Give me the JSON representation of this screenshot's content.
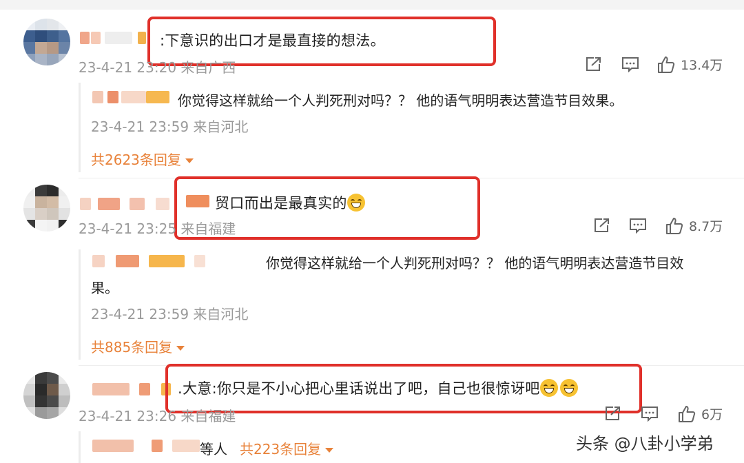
{
  "comments": [
    {
      "text": ":下意识的出口才是最直接的想法。",
      "meta": "23-4-21 23:20 来自广西",
      "likes": "13.4万",
      "reply": {
        "text": "你觉得这样就给一个人判死刑对吗？？ 他的语气明明表达营造节目效果。",
        "meta": "23-4-21 23:59 来自河北"
      },
      "more_replies": "共2623条回复"
    },
    {
      "text": "贸口而出是最真实的",
      "meta": "23-4-21 23:25 来自福建",
      "likes": "8.7万",
      "reply": {
        "text_line1": "你觉得这样就给一个人判死刑对吗？？ 他的语气明明表达营造节目效",
        "text_line2": "果。",
        "meta": "23-4-21 23:59 来自河北"
      },
      "more_replies": "共885条回复"
    },
    {
      "text": ".大意:你只是不小心把心里话说出了吧，自己也很惊讶吧",
      "meta": "23-4-21 23:26 来自福建",
      "likes": "6万",
      "reply_prefix": "等人",
      "more_replies": "共223条回复"
    }
  ],
  "icons": [
    "share-icon",
    "comment-icon",
    "thumb-up-icon"
  ],
  "colors": {
    "highlight_box": "#e0302a",
    "link": "#e8823a",
    "meta": "#9a9a9a"
  },
  "watermark": "头条 @八卦小学弟"
}
